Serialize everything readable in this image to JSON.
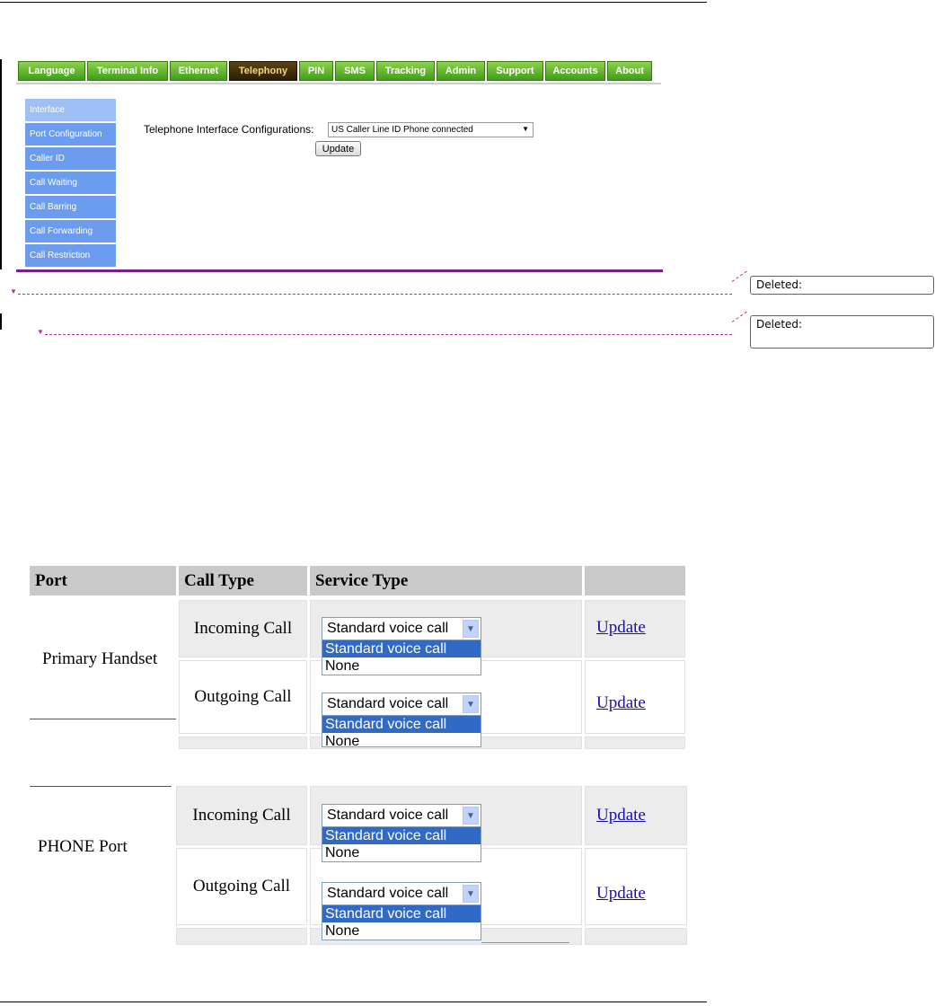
{
  "nav": {
    "tabs": [
      "Language",
      "Terminal Info",
      "Ethernet",
      "Telephony",
      "PIN",
      "SMS",
      "Tracking",
      "Admin",
      "Support",
      "Accounts",
      "About"
    ],
    "active": "Telephony"
  },
  "sidebar": {
    "items": [
      "Interface",
      "Port Configuration",
      "Caller ID",
      "Call Waiting",
      "Call Barring",
      "Call Forwarding",
      "Call Restriction"
    ]
  },
  "config": {
    "label": "Telephone Interface Configurations:",
    "selected": "US Caller Line ID Phone connected",
    "update_label": "Update"
  },
  "comments": [
    {
      "label": "Deleted:"
    },
    {
      "label": "Deleted:"
    }
  ],
  "table": {
    "headers": [
      "Port",
      "Call Type",
      "Service Type",
      ""
    ],
    "ports": [
      {
        "name": "Primary Handset",
        "rows": [
          {
            "call_type": "Incoming Call",
            "service": "Standard voice call",
            "options": [
              "Standard voice call",
              "None"
            ],
            "action": "Update"
          },
          {
            "call_type": "Outgoing Call",
            "service": "Standard voice call",
            "options": [
              "Standard voice call",
              "None"
            ],
            "action": "Update"
          }
        ]
      },
      {
        "name": "PHONE Port",
        "rows": [
          {
            "call_type": "Incoming Call",
            "service": "Standard voice call",
            "options": [
              "Standard voice call",
              "None"
            ],
            "action": "Update"
          },
          {
            "call_type": "Outgoing Call",
            "service": "Standard voice call",
            "options": [
              "Standard voice call",
              "None"
            ],
            "action": "Update"
          }
        ]
      }
    ]
  },
  "colors": {
    "tab_green": "#4aa81f",
    "tab_active": "#3a2a08",
    "sidebar_blue": "#6b9cf0",
    "divider_purple": "#7a1f8a",
    "comment_magenta": "#b0308f",
    "select_highlight": "#3169c6",
    "link_blue": "#1a0dab"
  }
}
